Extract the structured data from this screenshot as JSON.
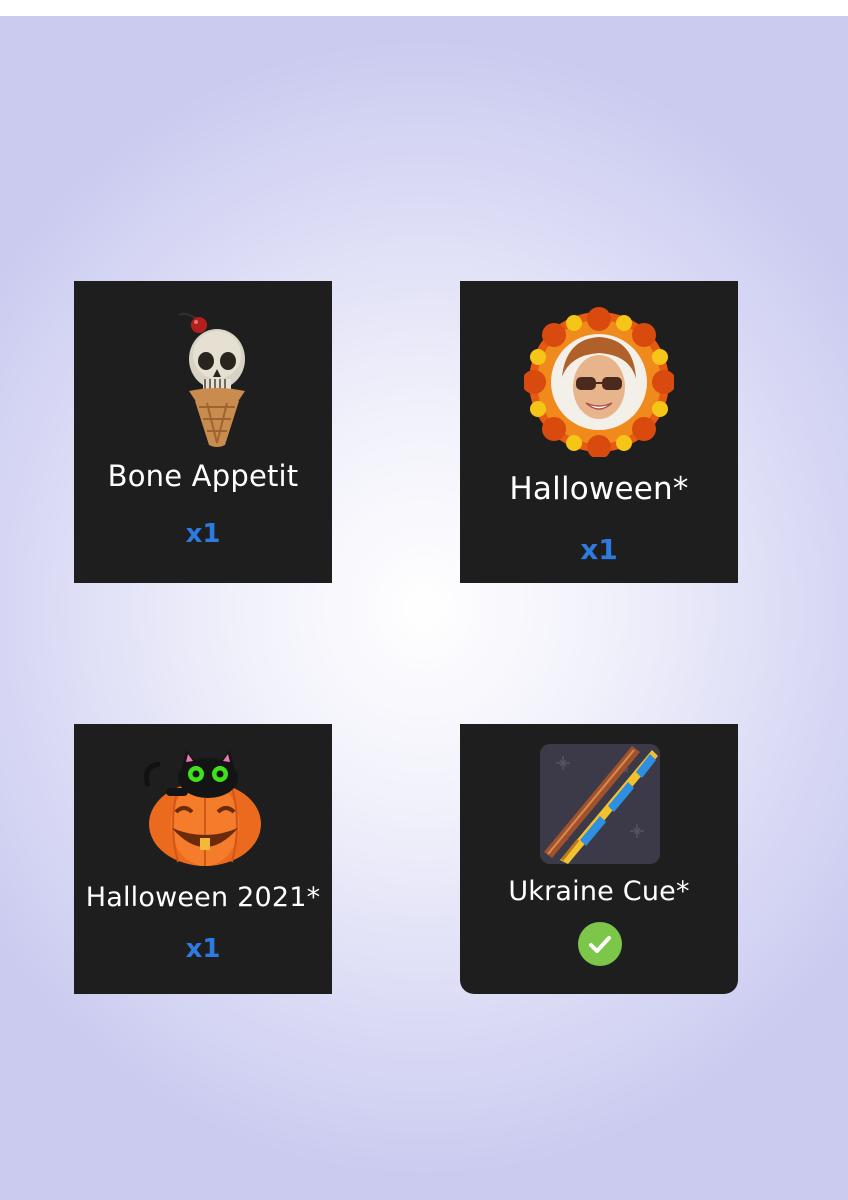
{
  "items": [
    {
      "name": "Bone Appetit",
      "quantity": "x1",
      "icon": "skull-ice-cream-icon"
    },
    {
      "name": "Halloween*",
      "quantity": "x1",
      "icon": "halloween-wreath-avatar-icon"
    },
    {
      "name": "Halloween 2021*",
      "quantity": "x1",
      "icon": "cat-pumpkin-icon"
    },
    {
      "name": "Ukraine Cue*",
      "status": "equipped",
      "icon": "ukraine-cue-icon"
    }
  ],
  "colors": {
    "card_bg": "#1e1e1e",
    "quantity_text": "#2d7be0",
    "check_green": "#7cc64a"
  }
}
